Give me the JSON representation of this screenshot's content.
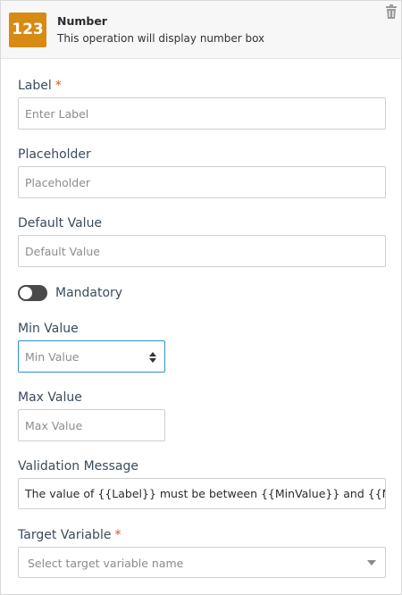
{
  "header": {
    "icon_text": "123",
    "title": "Number",
    "subtitle": "This operation will display number box",
    "delete_icon": "trash-icon",
    "accent": "#d98a12"
  },
  "fields": {
    "label": {
      "label": "Label",
      "required_mark": "*",
      "placeholder": "Enter Label",
      "value": ""
    },
    "placeholder": {
      "label": "Placeholder",
      "placeholder": "Placeholder",
      "value": ""
    },
    "default_value": {
      "label": "Default Value",
      "placeholder": "Default Value",
      "value": ""
    },
    "mandatory": {
      "label": "Mandatory",
      "checked": false
    },
    "min_value": {
      "label": "Min Value",
      "placeholder": "Min Value",
      "value": "",
      "spinner_icon": "stepper-icon"
    },
    "max_value": {
      "label": "Max Value",
      "placeholder": "Max Value",
      "value": ""
    },
    "validation_message": {
      "label": "Validation Message",
      "value": "The value of {{Label}} must be between {{MinValue}} and {{MaxValue}}"
    },
    "target_variable": {
      "label": "Target Variable",
      "required_mark": "*",
      "placeholder": "Select target variable name",
      "caret_icon": "chevron-down-icon"
    }
  }
}
